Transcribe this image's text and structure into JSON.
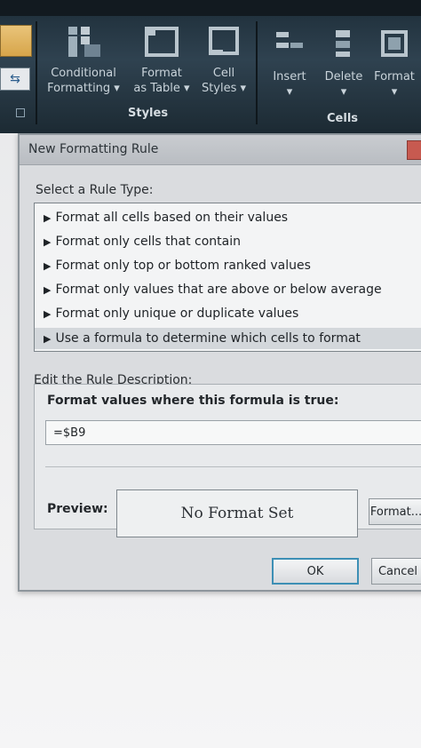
{
  "ribbon": {
    "conditional_formatting": {
      "line1": "Conditional",
      "line2": "Formatting ▾"
    },
    "format_as_table": {
      "line1": "Format",
      "line2": "as Table ▾"
    },
    "cell_styles": {
      "line1": "Cell",
      "line2": "Styles ▾"
    },
    "styles_group_label": "Styles",
    "insert": {
      "line1": "Insert",
      "line2": "▾"
    },
    "delete": {
      "line1": "Delete",
      "line2": "▾"
    },
    "format": {
      "line1": "Format",
      "line2": "▾"
    },
    "cells_group_label": "Cells"
  },
  "dialog": {
    "title": "New Formatting Rule",
    "select_rule_type_label": "Select a Rule Type:",
    "rule_types": [
      "Format all cells based on their values",
      "Format only cells that contain",
      "Format only top or bottom ranked values",
      "Format only values that are above or below average",
      "Format only unique or duplicate values",
      "Use a formula to determine which cells to format"
    ],
    "selected_rule_index": 5,
    "edit_rule_description_label": "Edit the Rule Description:",
    "formula_heading": "Format values where this formula is true:",
    "formula_value": "=$B9",
    "preview_label": "Preview:",
    "preview_text": "No Format Set",
    "format_button": "Format...",
    "ok_button": "OK",
    "cancel_button": "Cancel"
  }
}
